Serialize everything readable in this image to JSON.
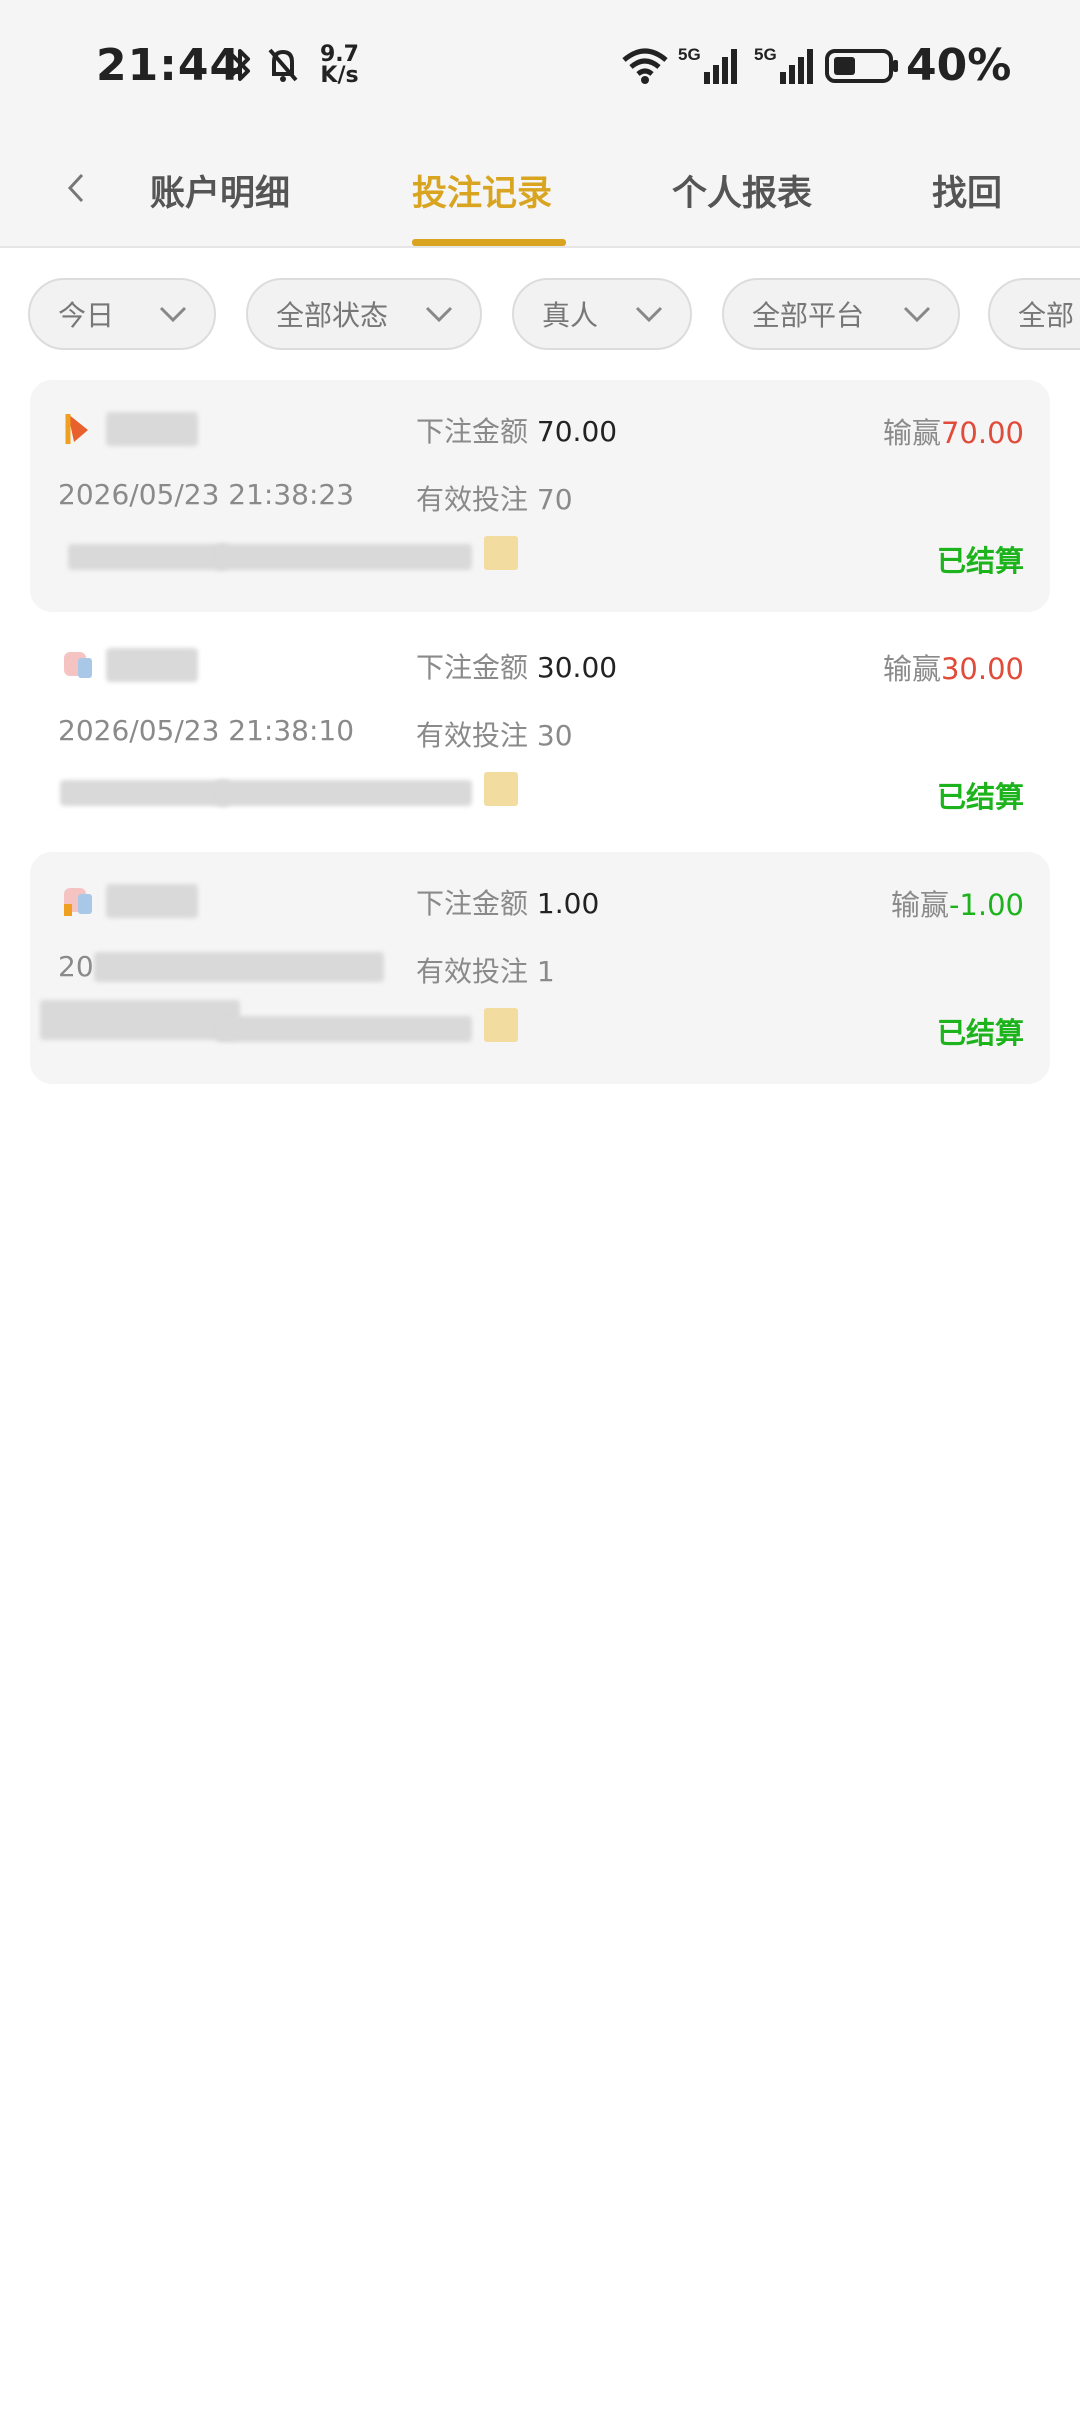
{
  "status_bar": {
    "time": "21:44",
    "net_speed_value": "9.7",
    "net_speed_unit": "K/s",
    "battery": "40%",
    "icons": [
      "bluetooth-icon",
      "mute-icon",
      "wifi-icon",
      "5g-signal-icon",
      "5g-signal-icon",
      "battery-icon"
    ]
  },
  "tabs": [
    {
      "label": "账户明细"
    },
    {
      "label": "投注记录"
    },
    {
      "label": "个人报表"
    },
    {
      "label": "找回"
    }
  ],
  "active_tab_index": 1,
  "filters": [
    {
      "label": "今日"
    },
    {
      "label": "全部状态"
    },
    {
      "label": "真人"
    },
    {
      "label": "全部平台"
    },
    {
      "label": "全部"
    }
  ],
  "labels": {
    "bet_amount": "下注金额",
    "valid_bet": "有效投注",
    "win_loss": "输赢"
  },
  "bets": [
    {
      "bet_amount": "70.00",
      "time": "2026/05/23 21:38:23",
      "valid_bet": "70",
      "win_loss": "70.00",
      "status": "已结算"
    },
    {
      "bet_amount": "30.00",
      "time": "2026/05/23 21:38:10",
      "valid_bet": "30",
      "win_loss": "30.00",
      "status": "已结算"
    },
    {
      "bet_amount": "1.00",
      "time": "20",
      "valid_bet": "1",
      "win_loss": "-1.00",
      "status": "已结算"
    }
  ],
  "colors": {
    "accent": "#d9a520",
    "win": "#e04b3a",
    "loss": "#1cb31c",
    "settled": "#1cb31c"
  }
}
